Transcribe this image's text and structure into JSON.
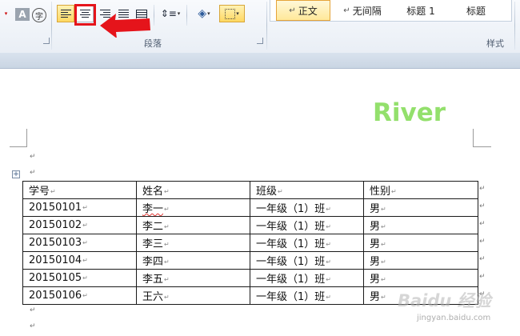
{
  "ribbon": {
    "paragraph_group_label": "段落",
    "styles_group_label": "样式",
    "font_a_glyph": "A",
    "phonetic_glyph": "字",
    "styles": [
      {
        "mark": "↵",
        "label": "正文",
        "selected": true
      },
      {
        "mark": "↵",
        "label": "无间隔",
        "selected": false
      },
      {
        "mark": "",
        "label": "标题 1",
        "selected": false
      },
      {
        "mark": "",
        "label": "标题",
        "selected": false
      }
    ],
    "active_button": "align-center",
    "highlight_colors": {
      "red_box": "#e5141b",
      "arrow": "#e5141b",
      "active_fill": "#ffd862"
    }
  },
  "document": {
    "watermark_text": "River",
    "watermark_color": "#93e06c",
    "paragraph_mark": "↵",
    "table_move_glyph": "+",
    "table": {
      "headers": [
        "学号",
        "姓名",
        "班级",
        "性别"
      ],
      "rows": [
        [
          "20150101",
          "李一",
          "一年级（1）班",
          "男"
        ],
        [
          "20150102",
          "李二",
          "一年级（1）班",
          "男"
        ],
        [
          "20150103",
          "李三",
          "一年级（1）班",
          "男"
        ],
        [
          "20150104",
          "李四",
          "一年级（1）班",
          "男"
        ],
        [
          "20150105",
          "李五",
          "一年级（1）班",
          "男"
        ],
        [
          "20150106",
          "王六",
          "一年级（1）班",
          "男"
        ]
      ]
    }
  },
  "site_watermark": {
    "logo": "Baidu 经验",
    "url": "jingyan.baidu.com"
  }
}
